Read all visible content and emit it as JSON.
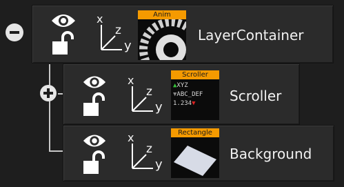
{
  "tree": {
    "nodes": [
      {
        "name": "LayerContainer",
        "expander": "collapse",
        "thumbnail": {
          "label": "Anim",
          "icon": "gear-wheel-icon"
        }
      },
      {
        "name": "Scroller",
        "expander": "expand",
        "thumbnail": {
          "label": "Scroller",
          "icon": "scroller-icon",
          "lines": [
            "XYZ",
            "ABC_DEF",
            "1.234"
          ]
        }
      },
      {
        "name": "Background",
        "expander": "",
        "thumbnail": {
          "label": "Rectangle",
          "icon": "rectangle-icon"
        }
      }
    ],
    "axis_labels": {
      "x": "x",
      "y": "y",
      "z": "z"
    }
  },
  "colors": {
    "background": "#1e1e1e",
    "node_background": "#2b2b2b",
    "badge_label": "#f59a00",
    "icon": "#ffffff"
  }
}
